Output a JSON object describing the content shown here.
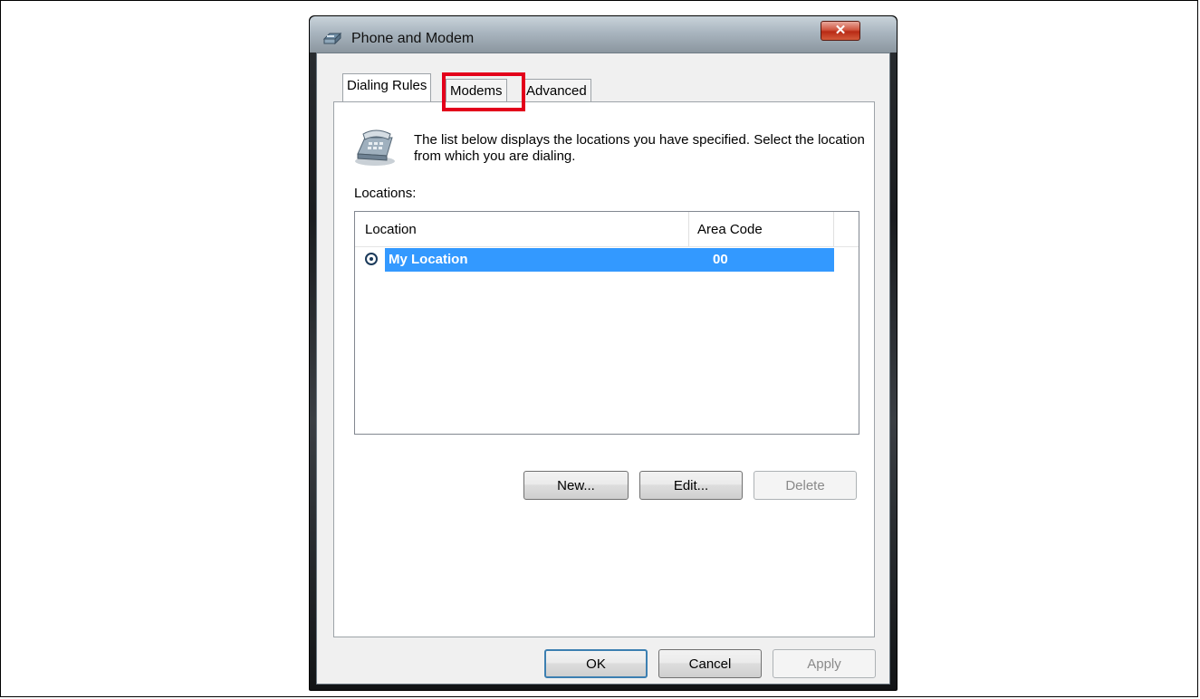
{
  "window": {
    "title": "Phone and Modem",
    "close_glyph": "✕"
  },
  "tabs": [
    {
      "label": "Dialing Rules",
      "active": true
    },
    {
      "label": "Modems",
      "active": false,
      "highlighted": true
    },
    {
      "label": "Advanced",
      "active": false
    }
  ],
  "dialing_rules": {
    "description": "The list below displays the locations you have specified. Select the location from which you are dialing.",
    "locations_label": "Locations:",
    "columns": [
      "Location",
      "Area Code"
    ],
    "rows": [
      {
        "location": "My Location",
        "area_code": "00",
        "selected": true
      }
    ],
    "buttons": {
      "new": "New...",
      "edit": "Edit...",
      "delete": "Delete"
    }
  },
  "footer": {
    "ok": "OK",
    "cancel": "Cancel",
    "apply": "Apply"
  },
  "colors": {
    "selection": "#3399ff",
    "highlight_box": "#e3001b",
    "close_button": "#c7422a"
  },
  "icons": [
    "phone-modem-icon",
    "telephone-icon",
    "close-icon",
    "radio-selected-icon"
  ]
}
